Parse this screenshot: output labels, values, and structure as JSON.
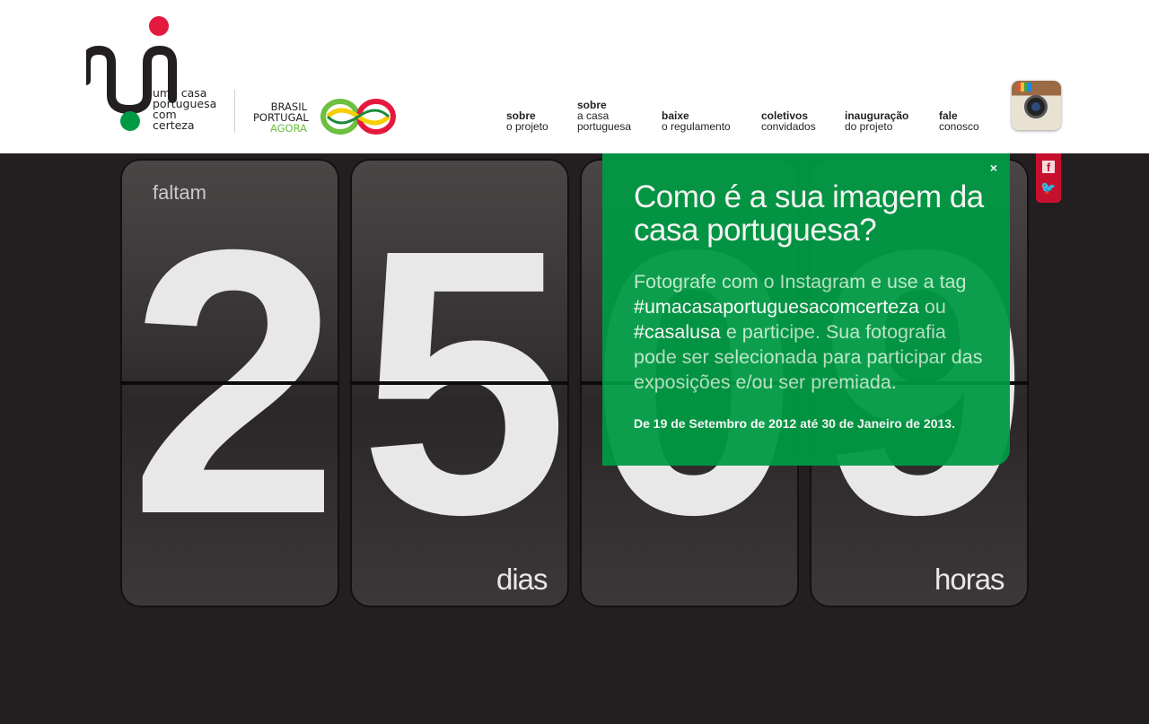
{
  "logo": {
    "lines": [
      "uma casa",
      "portuguesa",
      "com",
      "certeza"
    ],
    "partner_lines": [
      "BRASIL",
      "PORTUGAL",
      "AGORA"
    ]
  },
  "nav": [
    {
      "bold": "sobre",
      "regular": "o projeto"
    },
    {
      "bold": "sobre",
      "regular": "a casa",
      "regular2": "portuguesa"
    },
    {
      "bold": "baixe",
      "regular": "o regulamento"
    },
    {
      "bold": "coletivos",
      "regular": "convidados"
    },
    {
      "bold": "inauguração",
      "regular": "do projeto"
    },
    {
      "bold": "fale",
      "regular": "conosco"
    }
  ],
  "social": {
    "icons": [
      "instagram-icon",
      "facebook-icon",
      "twitter-icon"
    ]
  },
  "countdown": {
    "prefix": "faltam",
    "digits": [
      "2",
      "5",
      "0",
      "9"
    ],
    "days_label": "dias",
    "hours_label": "horas"
  },
  "popup": {
    "close": "×",
    "title": "Como é a sua imagem da casa portuguesa?",
    "text1": "Fotografe com o Instagram e use a tag",
    "tag1": "#umacasaportuguesacomcerteza",
    "text2": "ou",
    "tag2": "#casalusa",
    "text3": "e participe. Sua fotografia pode ser selecionada para participar das exposições e/ou ser premiada.",
    "dates": "De 19 de Setembro de 2012 até 30 de Janeiro de 2013."
  },
  "colors": {
    "brand_red": "#e4193d",
    "brand_green": "#009a44",
    "background": "#231f20"
  }
}
